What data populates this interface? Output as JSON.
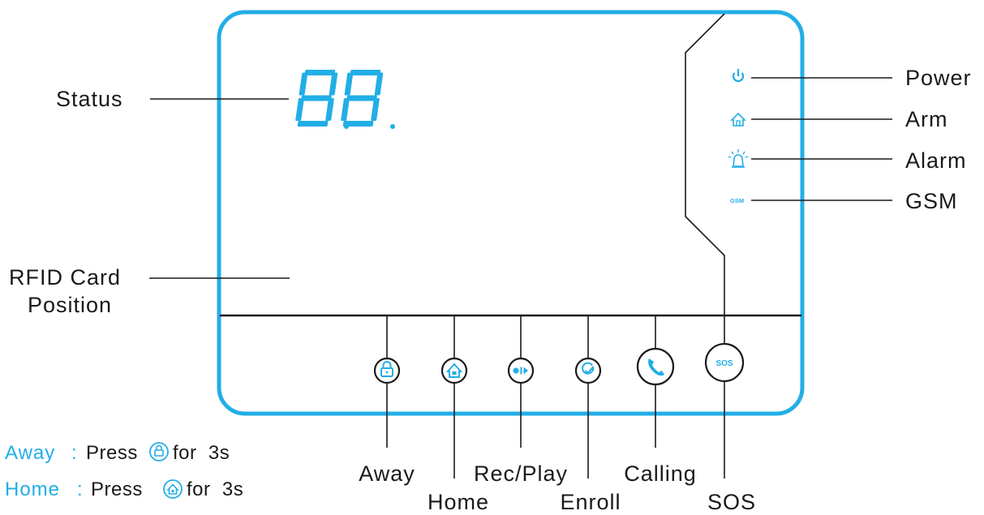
{
  "display": {
    "status_digits": "88"
  },
  "indicators": [
    {
      "id": "power",
      "label": "Power",
      "icon": "power-icon"
    },
    {
      "id": "arm",
      "label": "Arm",
      "icon": "home-outline-icon"
    },
    {
      "id": "alarm",
      "label": "Alarm",
      "icon": "siren-icon"
    },
    {
      "id": "gsm",
      "label": "GSM",
      "icon": "gsm-icon",
      "icon_text": "GSM"
    }
  ],
  "left_callouts": {
    "status": "Status",
    "rfid_line1": "RFID Card",
    "rfid_line2": "Position"
  },
  "buttons": [
    {
      "id": "away",
      "label": "Away",
      "icon": "padlock-icon"
    },
    {
      "id": "home",
      "label": "Home",
      "icon": "home-lock-icon"
    },
    {
      "id": "rec-play",
      "label": "Rec/Play",
      "icon": "record-play-icon"
    },
    {
      "id": "enroll",
      "label": "Enroll",
      "icon": "check-circle-icon"
    },
    {
      "id": "calling",
      "label": "Calling",
      "icon": "phone-icon"
    },
    {
      "id": "sos",
      "label": "SOS",
      "icon": "sos-icon",
      "icon_text": "SOS"
    }
  ],
  "legend": [
    {
      "key": "Away",
      "sep": ":",
      "press": "Press",
      "icon": "padlock-icon",
      "duration": "for  3s"
    },
    {
      "key": "Home",
      "sep": ":",
      "press": "Press",
      "icon": "home-lock-icon",
      "duration": "for  3s"
    }
  ],
  "colors": {
    "accent": "#22aee6",
    "line": "#1a1a1a",
    "background": "#ffffff"
  }
}
